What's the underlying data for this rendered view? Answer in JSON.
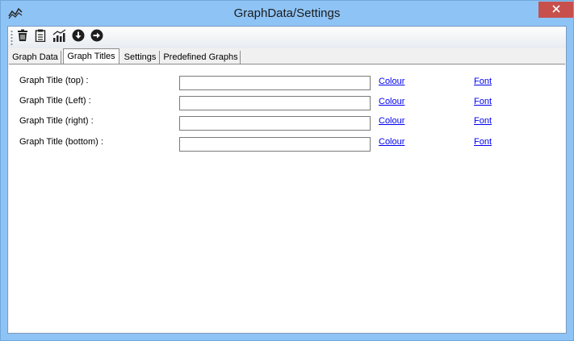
{
  "window": {
    "title": "GraphData/Settings",
    "icon": "line-chart-icon",
    "close_icon": "close-icon"
  },
  "toolbar": {
    "buttons": [
      {
        "icon": "trash-icon"
      },
      {
        "icon": "clipboard-icon"
      },
      {
        "icon": "bar-chart-icon"
      },
      {
        "icon": "arrow-down-circle-icon"
      },
      {
        "icon": "arrow-right-circle-icon"
      }
    ]
  },
  "tabs": [
    {
      "label": "Graph Data",
      "active": false
    },
    {
      "label": "Graph Titles",
      "active": true
    },
    {
      "label": "Settings",
      "active": false
    },
    {
      "label": "Predefined Graphs",
      "active": false
    }
  ],
  "graph_titles": {
    "rows": [
      {
        "label": "Graph Title (top) :",
        "value": "",
        "colour_link": "Colour",
        "font_link": "Font"
      },
      {
        "label": "Graph Title (Left) :",
        "value": "",
        "colour_link": "Colour",
        "font_link": "Font"
      },
      {
        "label": "Graph Title (right) :",
        "value": "",
        "colour_link": "Colour",
        "font_link": "Font"
      },
      {
        "label": "Graph Title (bottom) :",
        "value": "",
        "colour_link": "Colour",
        "font_link": "Font"
      }
    ]
  },
  "colors": {
    "title_bar": "#8ec3f5",
    "close_button": "#c7504c",
    "link": "#0000ee"
  }
}
